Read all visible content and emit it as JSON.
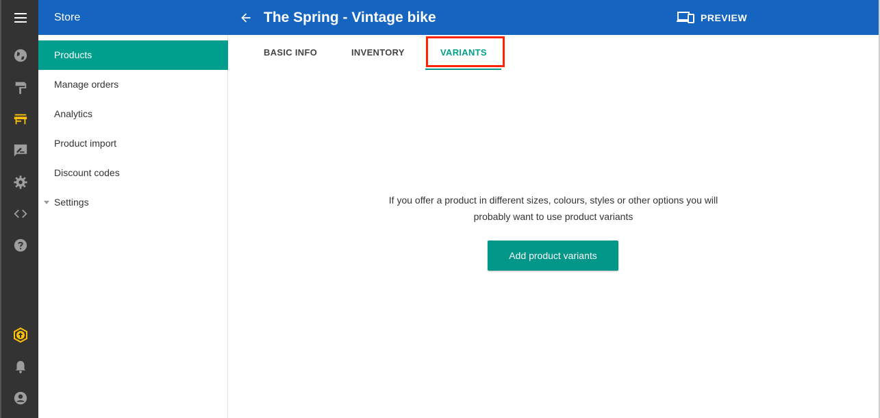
{
  "header": {
    "store_title": "Store",
    "page_title": "The Spring - Vintage bike",
    "preview_label": "PREVIEW"
  },
  "rail": {
    "icons": [
      "menu-icon",
      "globe-icon",
      "paint-roller-icon",
      "store-icon",
      "feedback-icon",
      "gear-icon",
      "code-icon",
      "help-icon",
      "upgrade-icon",
      "bell-icon",
      "account-icon"
    ],
    "active_icon": "store-icon",
    "active_color": "#ffc107"
  },
  "sidebar": {
    "items": [
      {
        "label": "Products",
        "active": true
      },
      {
        "label": "Manage orders"
      },
      {
        "label": "Analytics"
      },
      {
        "label": "Product import"
      },
      {
        "label": "Discount codes"
      },
      {
        "label": "Settings",
        "expandable": true
      }
    ]
  },
  "tabs": [
    {
      "label": "BASIC INFO"
    },
    {
      "label": "INVENTORY"
    },
    {
      "label": "VARIANTS",
      "active": true
    }
  ],
  "main": {
    "empty_text": "If you offer a product in different sizes, colours, styles or other options you will probably want to use product variants",
    "add_button_label": "Add product variants"
  },
  "colors": {
    "header_blue": "#1565c0",
    "accent_teal": "#009688",
    "rail_dark": "#333333",
    "highlight_red": "#ff2200"
  }
}
